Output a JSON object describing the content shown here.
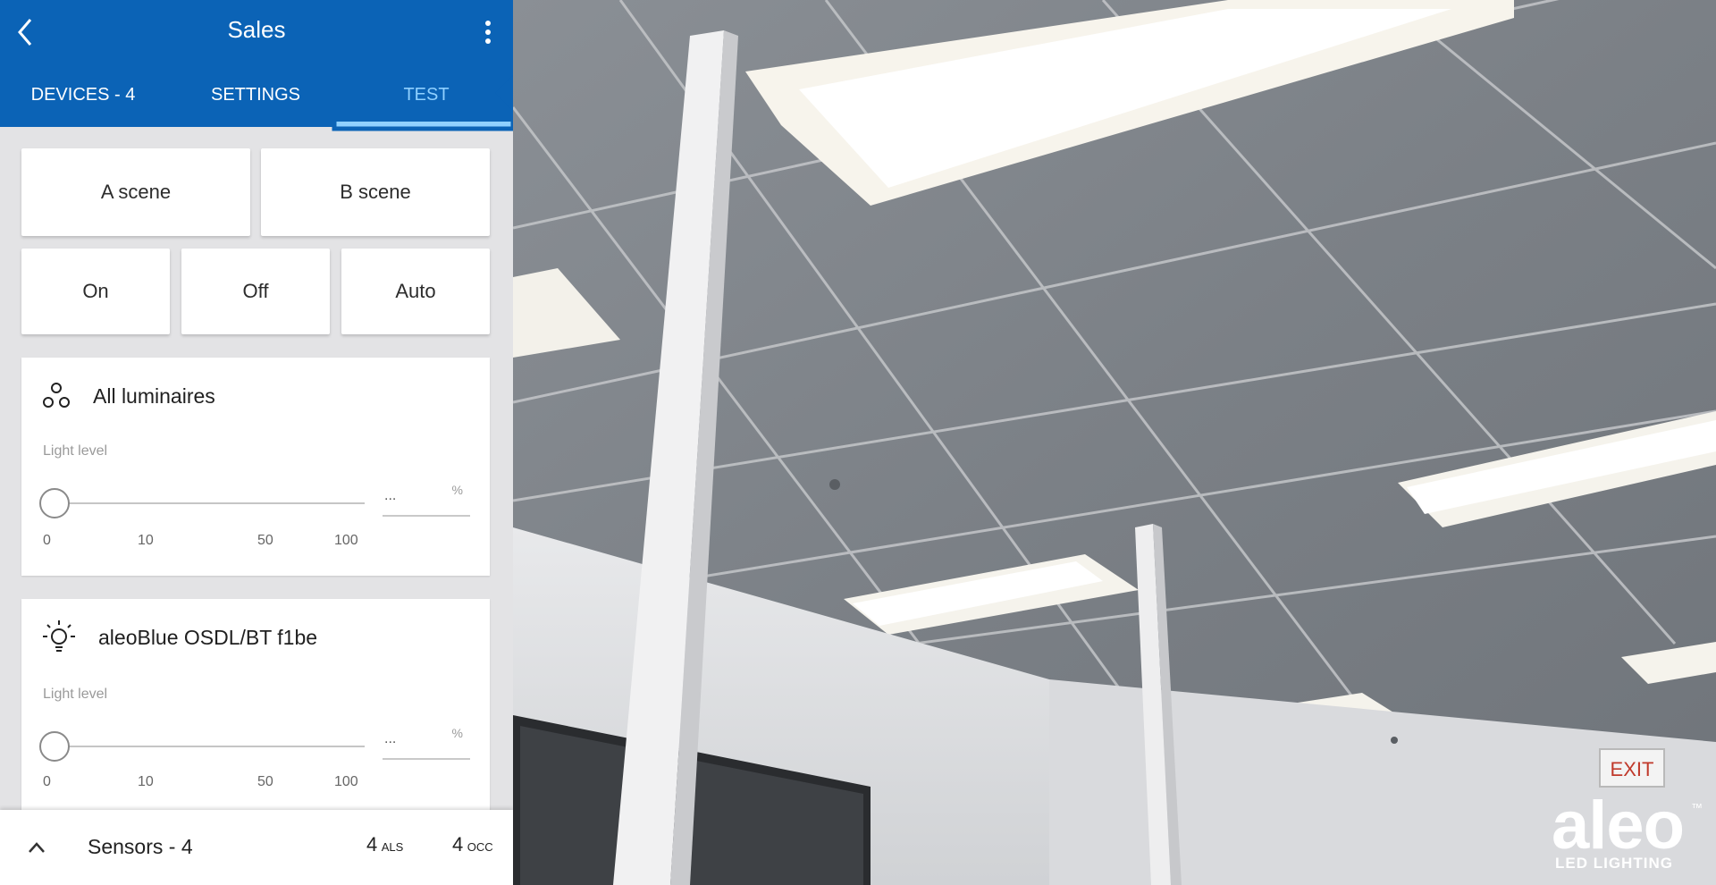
{
  "header": {
    "title": "Sales",
    "tabs": [
      {
        "label": "DEVICES - 4"
      },
      {
        "label": "SETTINGS"
      },
      {
        "label": "TEST"
      }
    ],
    "active_tab": "TEST"
  },
  "scenes": {
    "a": "A scene",
    "b": "B scene"
  },
  "modes": {
    "on": "On",
    "off": "Off",
    "auto": "Auto"
  },
  "cards": [
    {
      "icon": "group-icon",
      "title": "All luminaires",
      "light_label": "Light level",
      "value": "...",
      "unit": "%",
      "slider_level": 0,
      "ticks": [
        "0",
        "10",
        "50",
        "100"
      ]
    },
    {
      "icon": "bulb-icon",
      "title": "aleoBlue OSDL/BT f1be",
      "light_label": "Light level",
      "value": "...",
      "unit": "%",
      "slider_level": 0,
      "ticks": [
        "0",
        "10",
        "50",
        "100"
      ]
    }
  ],
  "sensors": {
    "label": "Sensors - 4",
    "als_count": "4",
    "als_label": "ALS",
    "occ_count": "4",
    "occ_label": "OCC"
  },
  "logo": {
    "word": "aleo",
    "tm": "™",
    "sub": "LED LIGHTING"
  },
  "scene_sign": "EXIT",
  "colors": {
    "app_bar": "#0b63b6",
    "active_tab": "#8fd0ff",
    "arrow": "#0b63b6",
    "panel_bg": "#e3e3e5"
  }
}
